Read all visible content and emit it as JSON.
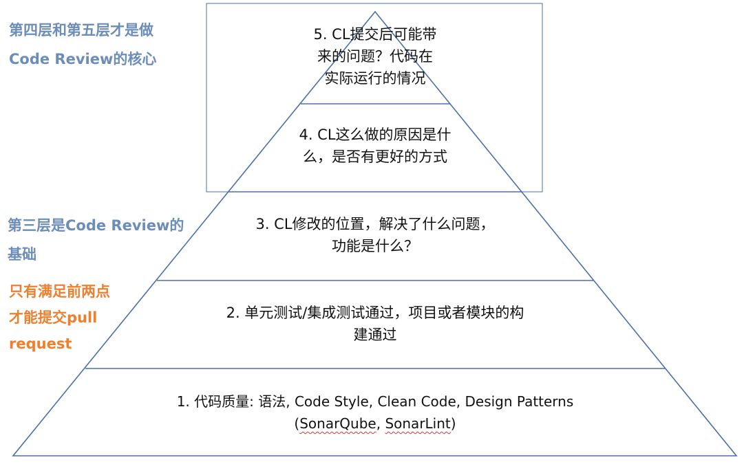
{
  "colors": {
    "outline": "#4A6FA8",
    "note_blue": "#6B8DB8",
    "note_orange": "#F07F2D",
    "text": "#111111"
  },
  "notes": {
    "core": [
      "第四层和第五层才是做",
      "Code Review的核心"
    ],
    "basis": [
      "第三层是Code Review的",
      "基础"
    ],
    "pull_request": [
      "只有满足前两点",
      "才能提交pull",
      "request"
    ]
  },
  "layers": {
    "layer5": [
      "5. CL提交后可能带",
      "来的问题？代码在",
      "实际运行的情况"
    ],
    "layer4": [
      "4. CL这么做的原因是什",
      "么，是否有更好的方式"
    ],
    "layer3": [
      "3. CL修改的位置，解决了什么问题，",
      "功能是什么？"
    ],
    "layer2": [
      "2. 单元测试/集成测试通过，项目或者模块的构",
      "建通过"
    ],
    "layer1": {
      "line1": "1. 代码质量: 语法, Code Style, Clean Code, Design Patterns",
      "line2_open": "(",
      "line2_term1": "SonarQube",
      "line2_sep": ", ",
      "line2_term2": "SonarLint",
      "line2_close": ")"
    }
  }
}
